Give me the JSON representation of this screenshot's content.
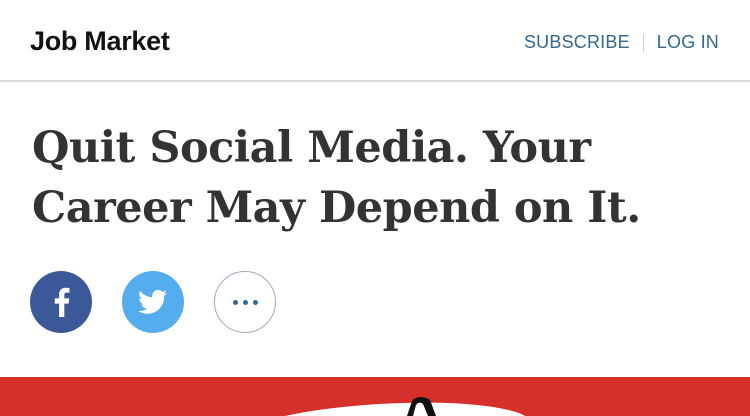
{
  "header": {
    "section_title": "Job Market",
    "subscribe_label": "SUBSCRIBE",
    "login_label": "LOG IN"
  },
  "article": {
    "headline": "Quit Social Media. Your Career May Depend on It."
  },
  "share": {
    "icons": [
      "facebook-icon",
      "twitter-icon",
      "more-options-icon"
    ]
  },
  "colors": {
    "link": "#326891",
    "facebook": "#3b5998",
    "twitter": "#55acee",
    "hero_background": "#d6302a"
  }
}
